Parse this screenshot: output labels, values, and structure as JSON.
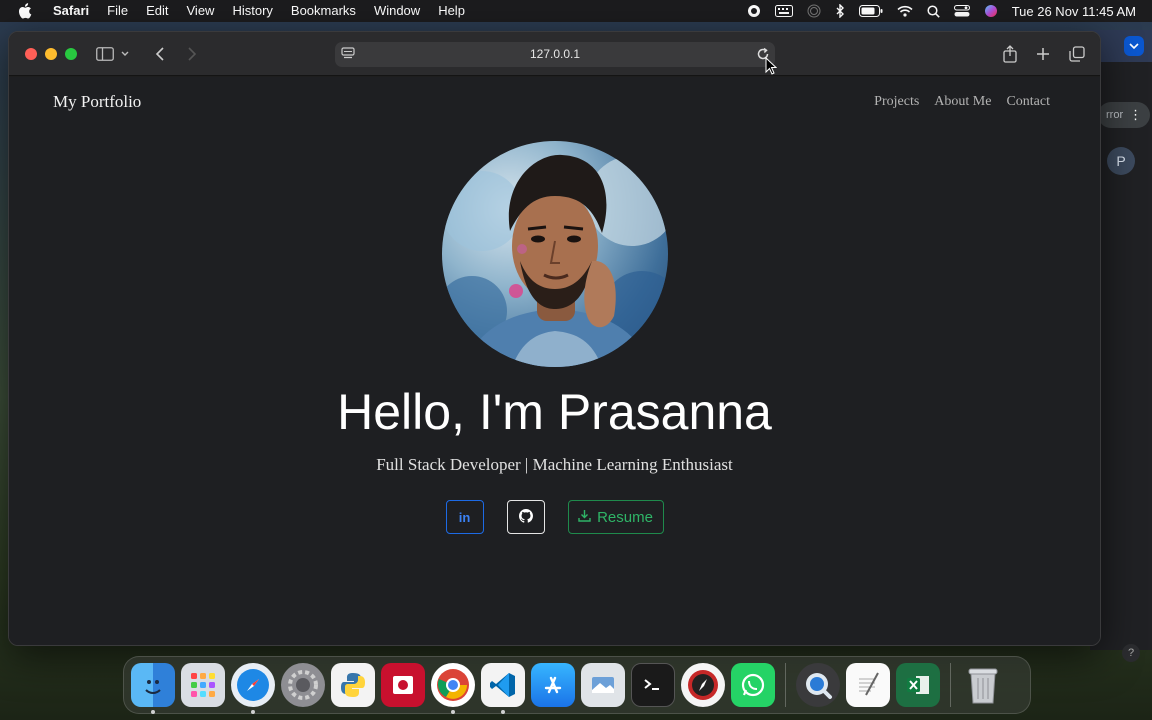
{
  "menubar": {
    "app_name": "Safari",
    "items": [
      "File",
      "Edit",
      "View",
      "History",
      "Bookmarks",
      "Window",
      "Help"
    ],
    "clock": "Tue 26 Nov  11:45 AM"
  },
  "browser": {
    "url": "127.0.0.1"
  },
  "background_window": {
    "pill_text": "rror",
    "avatar_letter": "P",
    "help_glyph": "?"
  },
  "page": {
    "brand": "My Portfolio",
    "nav": [
      "Projects",
      "About Me",
      "Contact"
    ],
    "hero": {
      "greeting": "Hello, ",
      "name": "I'm Prasanna",
      "subtitle": "Full Stack Developer | Machine Learning Enthusiast"
    },
    "buttons": {
      "linkedin": "in",
      "resume": "Resume"
    }
  },
  "dock": {
    "apps": [
      "finder-icon",
      "launchpad-icon",
      "safari-icon",
      "system-settings-icon",
      "python-icon",
      "photo-booth-icon",
      "chrome-icon",
      "vscode-icon",
      "app-store-icon",
      "preview-icon",
      "terminal-icon",
      "compass-icon",
      "whatsapp-icon",
      "quicktime-icon",
      "textedit-icon",
      "excel-icon",
      "trash-icon"
    ]
  },
  "colors": {
    "accent_blue": "#1d6ae5",
    "accent_green": "#1f8a4c",
    "page_bg": "#1e1f22"
  }
}
